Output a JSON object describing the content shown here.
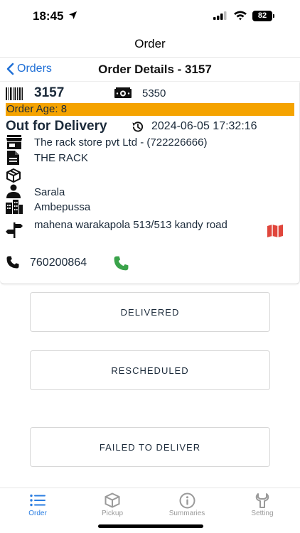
{
  "status_bar": {
    "time": "18:45",
    "battery": "82"
  },
  "nav": {
    "title": "Order"
  },
  "sub_header": {
    "back_label": "Orders",
    "title": "Order Details - 3157"
  },
  "order": {
    "id": "3157",
    "cash_amount": "5350",
    "age": "Order Age: 8",
    "status": "Out for Delivery",
    "status_time": "2024-06-05 17:32:16",
    "store": "The rack store pvt Ltd - (722226666)",
    "note": "THE RACK",
    "package": "",
    "customer_name": "Sarala",
    "city": "Ambepussa",
    "address": "mahena warakapola 513/513 kandy road",
    "phone": "760200864"
  },
  "actions": {
    "delivered": "DELIVERED",
    "rescheduled": "RESCHEDULED",
    "failed": "FAILED TO DELIVER"
  },
  "tabs": [
    {
      "label": "Order",
      "icon": "list-icon"
    },
    {
      "label": "Pickup",
      "icon": "box-icon"
    },
    {
      "label": "Summaries",
      "icon": "info-icon"
    },
    {
      "label": "Setting",
      "icon": "wrench-icon"
    }
  ],
  "colors": {
    "accent": "#2a7de1",
    "age_bar": "#f5a300",
    "text": "#1b2a3a",
    "phone_green": "#3aa34a",
    "map_red": "#e0463c"
  }
}
